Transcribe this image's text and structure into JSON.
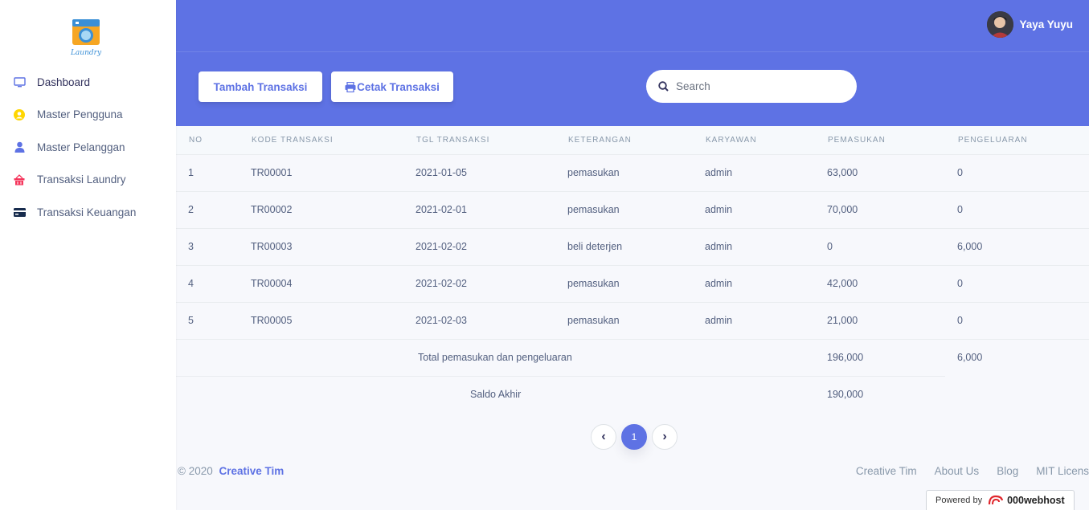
{
  "sidebar": {
    "logo_text": "Laundry",
    "items": [
      {
        "label": "Dashboard",
        "icon": "monitor-icon",
        "color": "#5e72e4"
      },
      {
        "label": "Master Pengguna",
        "icon": "user-circle-icon",
        "color": "#ffd600"
      },
      {
        "label": "Master Pelanggan",
        "icon": "person-icon",
        "color": "#5e72e4"
      },
      {
        "label": "Transaksi Laundry",
        "icon": "basket-icon",
        "color": "#f5365c"
      },
      {
        "label": "Transaksi Keuangan",
        "icon": "card-icon",
        "color": "#172b4d"
      }
    ]
  },
  "header": {
    "user_name": "Yaya Yuyu",
    "tambah_label": "Tambah Transaksi",
    "cetak_label": "Cetak Transaksi",
    "search_placeholder": "Search",
    "accent": "#5e72e4"
  },
  "table": {
    "columns": [
      "NO",
      "KODE TRANSAKSI",
      "TGL TRANSAKSI",
      "KETERANGAN",
      "KARYAWAN",
      "PEMASUKAN",
      "PENGELUARAN"
    ],
    "rows": [
      [
        "1",
        "TR00001",
        "2021-01-05",
        "pemasukan",
        "admin",
        "63,000",
        "0"
      ],
      [
        "2",
        "TR00002",
        "2021-02-01",
        "pemasukan",
        "admin",
        "70,000",
        "0"
      ],
      [
        "3",
        "TR00003",
        "2021-02-02",
        "beli deterjen",
        "admin",
        "0",
        "6,000"
      ],
      [
        "4",
        "TR00004",
        "2021-02-02",
        "pemasukan",
        "admin",
        "42,000",
        "0"
      ],
      [
        "5",
        "TR00005",
        "2021-02-03",
        "pemasukan",
        "admin",
        "21,000",
        "0"
      ]
    ],
    "total_label": "Total pemasukan dan pengeluaran",
    "total_pemasukan": "196,000",
    "total_pengeluaran": "6,000",
    "saldo_label": "Saldo Akhir",
    "saldo_value": "190,000"
  },
  "pagination": {
    "prev": "‹",
    "current": "1",
    "next": "›"
  },
  "footer": {
    "copyright": "© 2020",
    "brand": "Creative Tim",
    "links": [
      "Creative Tim",
      "About Us",
      "Blog",
      "MIT Licens"
    ],
    "powered_label": "Powered by",
    "powered_brand": "000webhost"
  }
}
